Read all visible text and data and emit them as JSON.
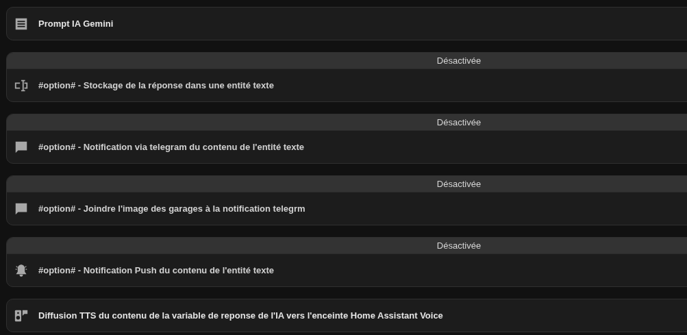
{
  "cards": [
    {
      "kind": "document",
      "label": "Prompt IA Gemini",
      "disabled": false
    },
    {
      "kind": "text-field",
      "label": "#option# - Stockage de la réponse dans une entité texte",
      "disabled": true,
      "banner": "Désactivée"
    },
    {
      "kind": "chat",
      "label": "#option# - Notification via telegram du contenu de l'entité texte",
      "disabled": true,
      "banner": "Désactivée"
    },
    {
      "kind": "chat",
      "label": "#option# - Joindre l'image des garages à la notification telegrm",
      "disabled": true,
      "banner": "Désactivée"
    },
    {
      "kind": "bell",
      "label": "#option# - Notification Push du contenu de l'entité texte",
      "disabled": true,
      "banner": "Désactivée"
    },
    {
      "kind": "speaker",
      "label": "Diffusion TTS du contenu de la variable de reponse de l'IA vers l'enceinte Home Assistant Voice",
      "disabled": false
    }
  ]
}
